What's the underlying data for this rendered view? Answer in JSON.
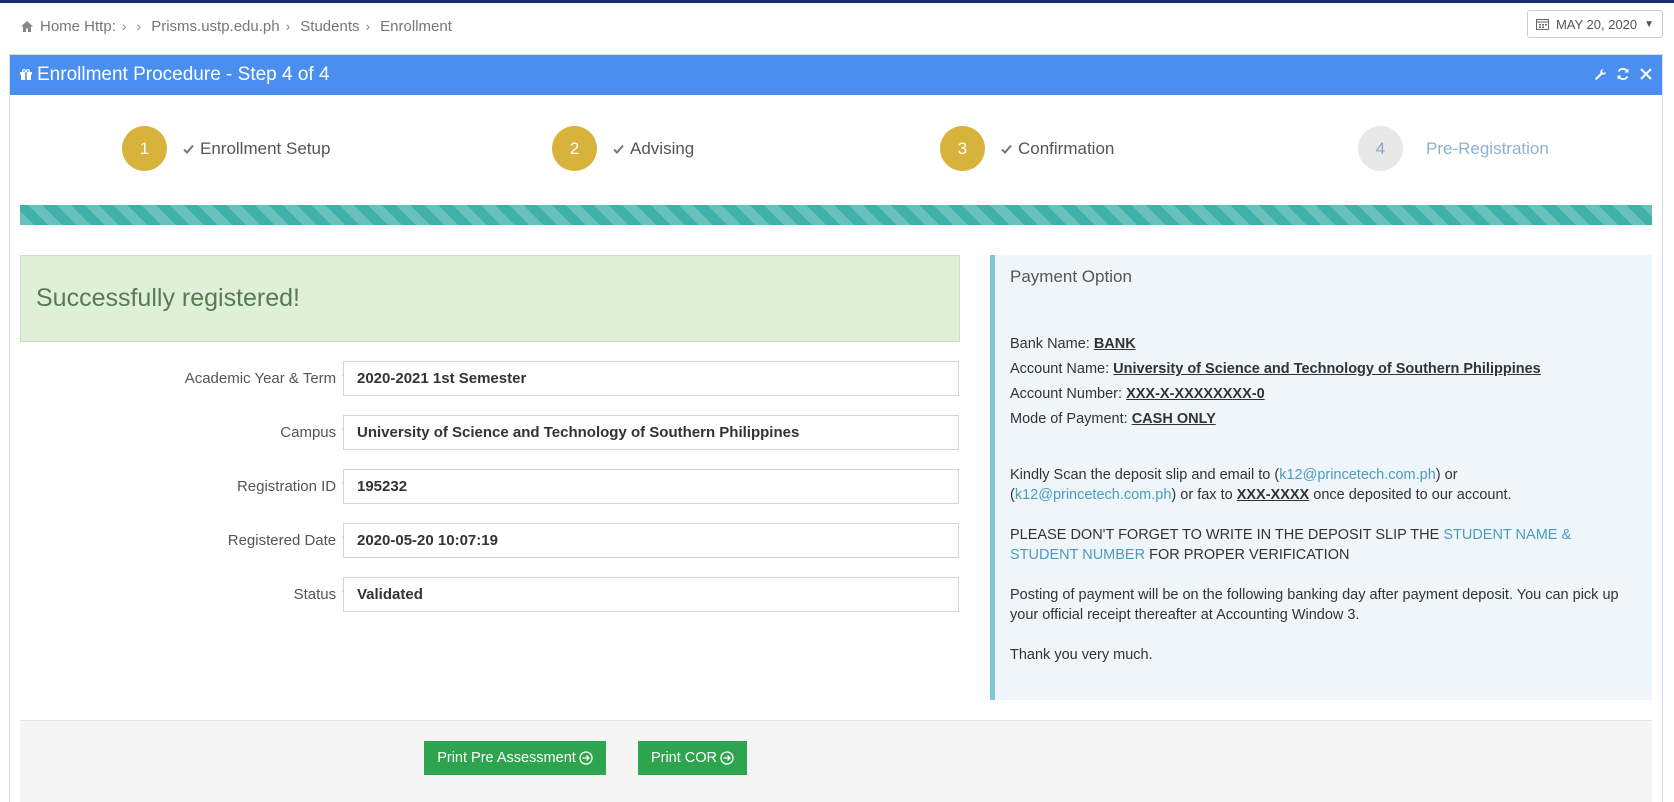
{
  "breadcrumb": {
    "items": [
      "Home Http:",
      "Prisms.ustp.edu.ph",
      "Students",
      "Enrollment"
    ]
  },
  "date_picker": {
    "value": "MAY 20, 2020"
  },
  "panel": {
    "title": "Enrollment Procedure - Step 4 of 4"
  },
  "steps": [
    {
      "number": "1",
      "label": "Enrollment Setup",
      "state": "done"
    },
    {
      "number": "2",
      "label": "Advising",
      "state": "done"
    },
    {
      "number": "3",
      "label": "Confirmation",
      "state": "done"
    },
    {
      "number": "4",
      "label": "Pre-Registration",
      "state": "pending"
    }
  ],
  "progress": {
    "percent": 100
  },
  "success_message": "Successfully registered!",
  "form": {
    "fields": [
      {
        "label": "Academic Year & Term",
        "value": "2020-2021 1st Semester"
      },
      {
        "label": "Campus",
        "value": "University of Science and Technology of Southern Philippines"
      },
      {
        "label": "Registration ID",
        "value": "195232"
      },
      {
        "label": "Registered Date",
        "value": "2020-05-20 10:07:19"
      },
      {
        "label": "Status",
        "value": "Validated"
      }
    ],
    "required_mark": "*"
  },
  "payment": {
    "title": "Payment Option",
    "bank_label": "Bank Name:",
    "bank_value": "BANK",
    "account_name_label": "Account Name:",
    "account_name_value": "University of Science and Technology of Southern Philippines",
    "account_number_label": "Account Number:",
    "account_number_value": "XXX-X-XXXXXXXX-0",
    "mode_label": "Mode of Payment:",
    "mode_value": "CASH ONLY",
    "scan_text_1": "Kindly Scan the deposit slip and email to (",
    "email_1": "k12@princetech.com.ph",
    "scan_text_2": ") or (",
    "email_2": "k12@princetech.com.ph",
    "scan_text_3": ") or fax to ",
    "fax_value": "XXX-XXXX",
    "scan_text_4": " once deposited to our account.",
    "reminder_text_1": "PLEASE DON'T FORGET TO WRITE IN THE DEPOSIT SLIP THE ",
    "reminder_highlight": "STUDENT NAME & STUDENT NUMBER",
    "reminder_text_2": " FOR PROPER VERIFICATION",
    "posting_text": "Posting of payment will be on the following banking day after payment deposit. You can pick up your official receipt thereafter at Accounting Window 3.",
    "thanks_text": "Thank you very much."
  },
  "buttons": {
    "print_pre_assessment": "Print Pre Assessment",
    "print_cor": "Print COR"
  },
  "colors": {
    "header_blue": "#4a8ff0",
    "step_done": "#d7b33c",
    "progress_teal": "#3fb0aa",
    "button_green": "#2ea44f"
  }
}
